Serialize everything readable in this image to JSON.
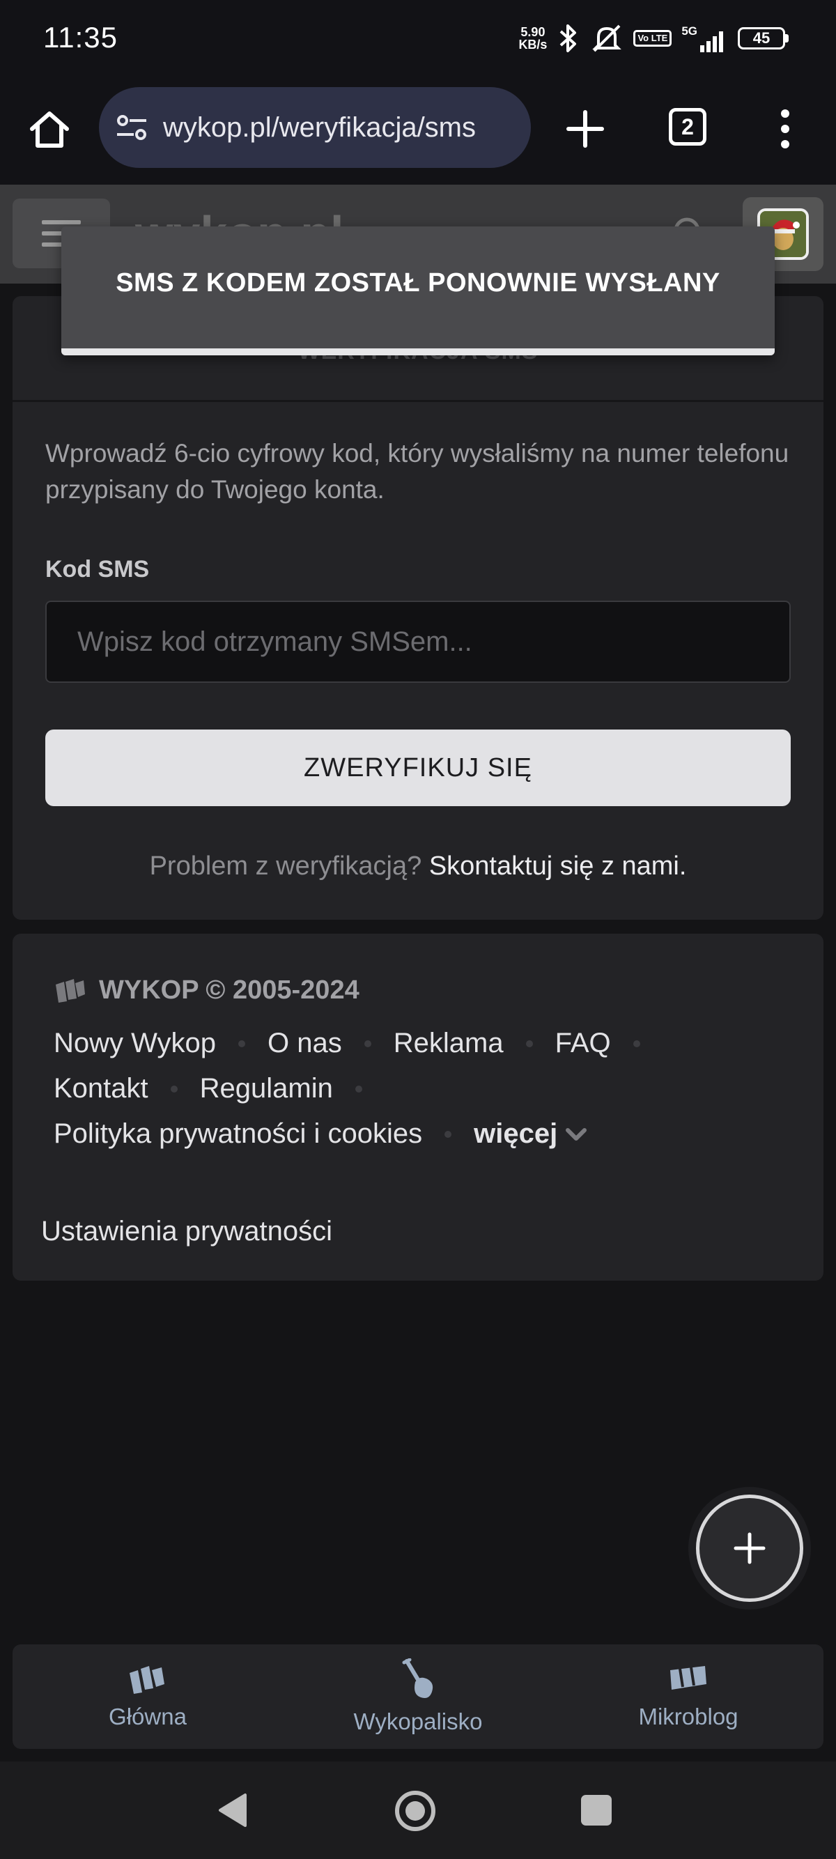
{
  "status_bar": {
    "time": "11:35",
    "net_speed_value": "5.90",
    "net_speed_unit": "KB/s",
    "volte": "Vo LTE",
    "network": "5G",
    "battery": "45"
  },
  "browser": {
    "url": "wykop.pl/weryfikacja/sms",
    "tab_count": "2"
  },
  "site_header": {
    "logo_text": "wykop.pl"
  },
  "toast": {
    "message": "SMS Z KODEM ZOSTAŁ PONOWNIE WYSŁANY"
  },
  "verification": {
    "title": "WERYFIKACJA SMS",
    "description": "Wprowadź 6-cio cyfrowy kod, który wysłaliśmy na numer telefonu przypisany do Twojego konta.",
    "field_label": "Kod SMS",
    "input_placeholder": "Wpisz kod otrzymany SMSem...",
    "input_value": "",
    "submit_label": "ZWERYFIKUJ SIĘ",
    "help_text": "Problem z weryfikacją?",
    "help_link": "Skontaktuj się z nami."
  },
  "footer": {
    "brand": "WYKOP © 2005-2024",
    "links": [
      "Nowy Wykop",
      "O nas",
      "Reklama",
      "FAQ",
      "Kontakt",
      "Regulamin",
      "Polityka prywatności i cookies"
    ],
    "more_label": "więcej",
    "privacy_settings": "Ustawienia prywatności"
  },
  "bottom_nav": {
    "items": [
      {
        "label": "Główna",
        "icon": "wykop-logo-icon"
      },
      {
        "label": "Wykopalisko",
        "icon": "shovel-icon"
      },
      {
        "label": "Mikroblog",
        "icon": "microblog-icon"
      }
    ]
  },
  "colors": {
    "background": "#141416",
    "card": "#232326",
    "nav_label": "#9eafc4",
    "url_pill": "#2e3147",
    "button": "#e2e2e5"
  }
}
